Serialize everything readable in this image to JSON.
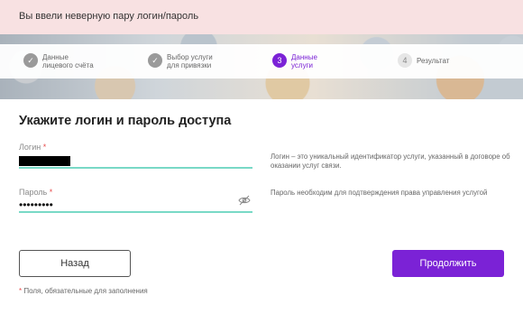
{
  "error": {
    "message": "Вы ввели неверную пару логин/пароль"
  },
  "steps": [
    {
      "number": "✓",
      "label_line1": "Данные",
      "label_line2": "лицевого счёта",
      "state": "done"
    },
    {
      "number": "✓",
      "label_line1": "Выбор услуги",
      "label_line2": "для привязки",
      "state": "done"
    },
    {
      "number": "3",
      "label_line1": "Данные",
      "label_line2": "услуги",
      "state": "active"
    },
    {
      "number": "4",
      "label_line1": "Результат",
      "label_line2": "",
      "state": "pending"
    }
  ],
  "form": {
    "title": "Укажите логин и пароль доступа",
    "login": {
      "label": "Логин",
      "required_mark": "*"
    },
    "password": {
      "label": "Пароль",
      "required_mark": "*",
      "value": "•••••••••"
    },
    "login_hint": "Логин – это уникальный идентификатор услуги, указанный в договоре об оказании услуг связи.",
    "password_hint": "Пароль необходим для подтверждения права управления услугой"
  },
  "buttons": {
    "back": "Назад",
    "next": "Продолжить"
  },
  "footer": {
    "required_mark": "*",
    "required_note": " Поля, обязательные для заполнения"
  },
  "colors": {
    "accent": "#7b22d6",
    "field_underline": "#79d9c6",
    "error_bg": "#f8e1e2"
  }
}
